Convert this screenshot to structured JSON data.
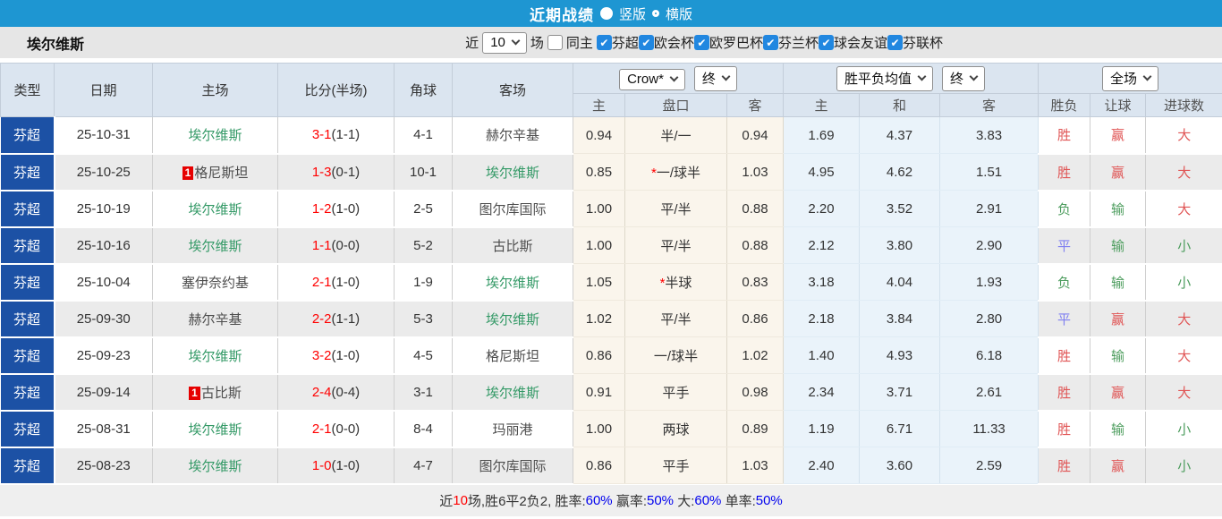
{
  "colors": {
    "topbar": "#1e96d2",
    "type_cell": "#1c51a5",
    "focus_team": "#339966",
    "score_red": "#ff0000",
    "result_red": "#e05555",
    "result_green": "#4d9d5e",
    "result_blue": "#8080f0",
    "odds_bg": "#faf5ec",
    "avg_bg": "#eaf3fa",
    "header_bg": "#dbe5f0",
    "checkbox_blue": "#2187e0"
  },
  "titlebar": {
    "title": "近期战绩",
    "radio_vertical": "竖版",
    "radio_horizontal": "横版",
    "selected": "竖版"
  },
  "filter": {
    "team": "埃尔维斯",
    "near_label": "近",
    "count_value": "10",
    "games_label": "场",
    "same_home_label": "同主",
    "same_home_checked": false,
    "leagues": [
      {
        "label": "芬超",
        "checked": true
      },
      {
        "label": "欧会杯",
        "checked": true
      },
      {
        "label": "欧罗巴杯",
        "checked": true
      },
      {
        "label": "芬兰杯",
        "checked": true
      },
      {
        "label": "球会友谊",
        "checked": true
      },
      {
        "label": "芬联杯",
        "checked": true
      }
    ]
  },
  "table": {
    "left_headers": [
      "类型",
      "日期",
      "主场",
      "比分(半场)",
      "角球",
      "客场"
    ],
    "group_odds": {
      "select1": "Crow*",
      "select2": "终",
      "sub": [
        "主",
        "盘口",
        "客"
      ]
    },
    "group_avg": {
      "select1": "胜平负均值",
      "select2": "终",
      "sub": [
        "主",
        "和",
        "客"
      ]
    },
    "group_result": {
      "select1": "全场",
      "sub": [
        "胜负",
        "让球",
        "进球数"
      ]
    },
    "rows": [
      {
        "type": "芬超",
        "date": "25-10-31",
        "home": {
          "name": "埃尔维斯",
          "focus": true
        },
        "score": "3-1",
        "half": "(1-1)",
        "corner": "4-1",
        "away": {
          "name": "赫尔辛基",
          "focus": false
        },
        "odds": {
          "home": "0.94",
          "line": "半/一",
          "star": false,
          "away": "0.94"
        },
        "avg": {
          "home": "1.69",
          "draw": "4.37",
          "away": "3.83"
        },
        "result": {
          "wdl": {
            "t": "胜",
            "c": "r"
          },
          "handicap": {
            "t": "赢",
            "c": "r"
          },
          "goals": {
            "t": "大",
            "c": "r"
          }
        }
      },
      {
        "type": "芬超",
        "date": "25-10-25",
        "home": {
          "name": "格尼斯坦",
          "focus": false,
          "badge": "1"
        },
        "score": "1-3",
        "half": "(0-1)",
        "corner": "10-1",
        "away": {
          "name": "埃尔维斯",
          "focus": true
        },
        "odds": {
          "home": "0.85",
          "line": "一/球半",
          "star": true,
          "away": "1.03"
        },
        "avg": {
          "home": "4.95",
          "draw": "4.62",
          "away": "1.51"
        },
        "result": {
          "wdl": {
            "t": "胜",
            "c": "r"
          },
          "handicap": {
            "t": "赢",
            "c": "r"
          },
          "goals": {
            "t": "大",
            "c": "r"
          }
        }
      },
      {
        "type": "芬超",
        "date": "25-10-19",
        "home": {
          "name": "埃尔维斯",
          "focus": true
        },
        "score": "1-2",
        "half": "(1-0)",
        "corner": "2-5",
        "away": {
          "name": "图尔库国际",
          "focus": false
        },
        "odds": {
          "home": "1.00",
          "line": "平/半",
          "star": false,
          "away": "0.88"
        },
        "avg": {
          "home": "2.20",
          "draw": "3.52",
          "away": "2.91"
        },
        "result": {
          "wdl": {
            "t": "负",
            "c": "g"
          },
          "handicap": {
            "t": "输",
            "c": "g"
          },
          "goals": {
            "t": "大",
            "c": "r"
          }
        }
      },
      {
        "type": "芬超",
        "date": "25-10-16",
        "home": {
          "name": "埃尔维斯",
          "focus": true
        },
        "score": "1-1",
        "half": "(0-0)",
        "corner": "5-2",
        "away": {
          "name": "古比斯",
          "focus": false
        },
        "odds": {
          "home": "1.00",
          "line": "平/半",
          "star": false,
          "away": "0.88"
        },
        "avg": {
          "home": "2.12",
          "draw": "3.80",
          "away": "2.90"
        },
        "result": {
          "wdl": {
            "t": "平",
            "c": "b"
          },
          "handicap": {
            "t": "输",
            "c": "g"
          },
          "goals": {
            "t": "小",
            "c": "g"
          }
        }
      },
      {
        "type": "芬超",
        "date": "25-10-04",
        "home": {
          "name": "塞伊奈约基",
          "focus": false
        },
        "score": "2-1",
        "half": "(1-0)",
        "corner": "1-9",
        "away": {
          "name": "埃尔维斯",
          "focus": true
        },
        "odds": {
          "home": "1.05",
          "line": "半球",
          "star": true,
          "away": "0.83"
        },
        "avg": {
          "home": "3.18",
          "draw": "4.04",
          "away": "1.93"
        },
        "result": {
          "wdl": {
            "t": "负",
            "c": "g"
          },
          "handicap": {
            "t": "输",
            "c": "g"
          },
          "goals": {
            "t": "小",
            "c": "g"
          }
        }
      },
      {
        "type": "芬超",
        "date": "25-09-30",
        "home": {
          "name": "赫尔辛基",
          "focus": false
        },
        "score": "2-2",
        "half": "(1-1)",
        "corner": "5-3",
        "away": {
          "name": "埃尔维斯",
          "focus": true
        },
        "odds": {
          "home": "1.02",
          "line": "平/半",
          "star": false,
          "away": "0.86"
        },
        "avg": {
          "home": "2.18",
          "draw": "3.84",
          "away": "2.80"
        },
        "result": {
          "wdl": {
            "t": "平",
            "c": "b"
          },
          "handicap": {
            "t": "赢",
            "c": "r"
          },
          "goals": {
            "t": "大",
            "c": "r"
          }
        }
      },
      {
        "type": "芬超",
        "date": "25-09-23",
        "home": {
          "name": "埃尔维斯",
          "focus": true
        },
        "score": "3-2",
        "half": "(1-0)",
        "corner": "4-5",
        "away": {
          "name": "格尼斯坦",
          "focus": false
        },
        "odds": {
          "home": "0.86",
          "line": "一/球半",
          "star": false,
          "away": "1.02"
        },
        "avg": {
          "home": "1.40",
          "draw": "4.93",
          "away": "6.18"
        },
        "result": {
          "wdl": {
            "t": "胜",
            "c": "r"
          },
          "handicap": {
            "t": "输",
            "c": "g"
          },
          "goals": {
            "t": "大",
            "c": "r"
          }
        }
      },
      {
        "type": "芬超",
        "date": "25-09-14",
        "home": {
          "name": "古比斯",
          "focus": false,
          "badge": "1"
        },
        "score": "2-4",
        "half": "(0-4)",
        "corner": "3-1",
        "away": {
          "name": "埃尔维斯",
          "focus": true
        },
        "odds": {
          "home": "0.91",
          "line": "平手",
          "star": false,
          "away": "0.98"
        },
        "avg": {
          "home": "2.34",
          "draw": "3.71",
          "away": "2.61"
        },
        "result": {
          "wdl": {
            "t": "胜",
            "c": "r"
          },
          "handicap": {
            "t": "赢",
            "c": "r"
          },
          "goals": {
            "t": "大",
            "c": "r"
          }
        }
      },
      {
        "type": "芬超",
        "date": "25-08-31",
        "home": {
          "name": "埃尔维斯",
          "focus": true
        },
        "score": "2-1",
        "half": "(0-0)",
        "corner": "8-4",
        "away": {
          "name": "玛丽港",
          "focus": false
        },
        "odds": {
          "home": "1.00",
          "line": "两球",
          "star": false,
          "away": "0.89"
        },
        "avg": {
          "home": "1.19",
          "draw": "6.71",
          "away": "11.33"
        },
        "result": {
          "wdl": {
            "t": "胜",
            "c": "r"
          },
          "handicap": {
            "t": "输",
            "c": "g"
          },
          "goals": {
            "t": "小",
            "c": "g"
          }
        }
      },
      {
        "type": "芬超",
        "date": "25-08-23",
        "home": {
          "name": "埃尔维斯",
          "focus": true
        },
        "score": "1-0",
        "half": "(1-0)",
        "corner": "4-7",
        "away": {
          "name": "图尔库国际",
          "focus": false
        },
        "odds": {
          "home": "0.86",
          "line": "平手",
          "star": false,
          "away": "1.03"
        },
        "avg": {
          "home": "2.40",
          "draw": "3.60",
          "away": "2.59"
        },
        "result": {
          "wdl": {
            "t": "胜",
            "c": "r"
          },
          "handicap": {
            "t": "赢",
            "c": "r"
          },
          "goals": {
            "t": "小",
            "c": "g"
          }
        }
      }
    ]
  },
  "footer": {
    "segments": [
      {
        "text": "近",
        "color": "dark"
      },
      {
        "text": "10",
        "color": "red"
      },
      {
        "text": "场,胜6平2负2, ",
        "color": "dark"
      },
      {
        "text": "胜率:",
        "color": "dark"
      },
      {
        "text": "60%",
        "color": "blue"
      },
      {
        "text": " 赢率:",
        "color": "dark"
      },
      {
        "text": "50%",
        "color": "blue"
      },
      {
        "text": " 大:",
        "color": "dark"
      },
      {
        "text": "60%",
        "color": "blue"
      },
      {
        "text": " 单率:",
        "color": "dark"
      },
      {
        "text": "50%",
        "color": "blue"
      }
    ]
  }
}
